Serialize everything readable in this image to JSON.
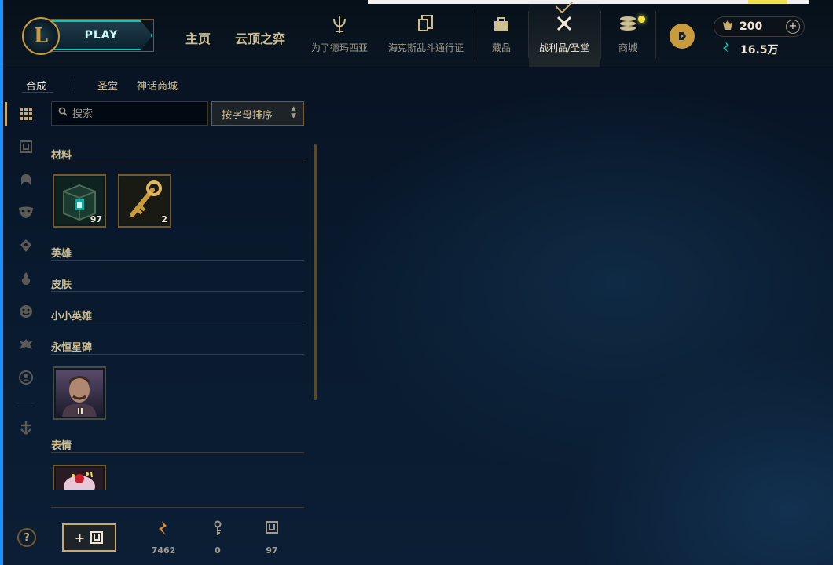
{
  "header": {
    "logo": "L",
    "play_label": "PLAY",
    "nav_main": [
      "主页",
      "云顶之弈"
    ],
    "nav_icons": [
      {
        "label": "为了德玛西亚",
        "icon": "trophy-icon"
      },
      {
        "label": "海克斯乱斗通行证",
        "icon": "pass-icon"
      },
      {
        "label": "藏品",
        "icon": "collection-icon"
      },
      {
        "label": "战利品/圣堂",
        "icon": "loot-icon"
      },
      {
        "label": "商城",
        "icon": "store-icon"
      }
    ],
    "active_nav": "战利品/圣堂",
    "rp_value": "200",
    "rp_plus": "+",
    "be_value": "16.5万"
  },
  "subtabs": [
    "合成",
    "圣堂",
    "神话商城"
  ],
  "search": {
    "placeholder": "搜索"
  },
  "sort": {
    "label": "按字母排序"
  },
  "categories": [
    {
      "name": "材料",
      "items": [
        {
          "type": "hextech-chest",
          "count": "97"
        },
        {
          "type": "hextech-key",
          "count": "2"
        }
      ]
    },
    {
      "name": "英雄"
    },
    {
      "name": "皮肤"
    },
    {
      "name": "小小英雄"
    },
    {
      "name": "永恒星碑",
      "items": [
        {
          "type": "eternal-draven",
          "count": "II"
        }
      ]
    },
    {
      "name": "表情",
      "items": [
        {
          "type": "emote"
        }
      ]
    }
  ],
  "bottom": {
    "add_button": "+",
    "resources": [
      {
        "name": "orange-essence",
        "value": "7462"
      },
      {
        "name": "key-fragments",
        "value": "0"
      },
      {
        "name": "chests",
        "value": "97"
      }
    ]
  },
  "colors": {
    "gold": "#c8aa6e",
    "accent": "#0ac8b9",
    "bg": "#0a1428"
  }
}
